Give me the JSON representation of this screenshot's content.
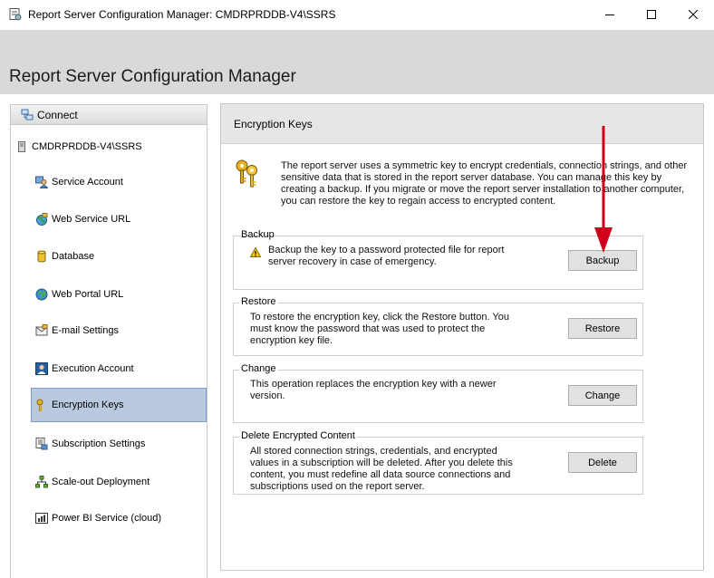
{
  "window": {
    "title": "Report Server Configuration Manager: CMDRPRDDB-V4\\SSRS",
    "controls": [
      "minimize-icon",
      "maximize-icon",
      "close-icon"
    ]
  },
  "header": {
    "app_title": "Report Server Configuration Manager"
  },
  "sidebar": {
    "connect_label": "Connect",
    "server_label": "CMDRPRDDB-V4\\SSRS",
    "items": [
      {
        "label": "Service Account",
        "icon": "service-account-icon"
      },
      {
        "label": "Web Service URL",
        "icon": "web-service-icon"
      },
      {
        "label": "Database",
        "icon": "database-icon"
      },
      {
        "label": "Web Portal URL",
        "icon": "globe-icon"
      },
      {
        "label": "E-mail Settings",
        "icon": "email-icon"
      },
      {
        "label": "Execution Account",
        "icon": "execution-account-icon"
      },
      {
        "label": "Encryption Keys",
        "icon": "key-icon",
        "selected": true
      },
      {
        "label": "Subscription Settings",
        "icon": "subscription-icon"
      },
      {
        "label": "Scale-out Deployment",
        "icon": "scaleout-icon"
      },
      {
        "label": "Power BI Service (cloud)",
        "icon": "power-bi-icon"
      }
    ]
  },
  "main": {
    "title": "Encryption Keys",
    "intro": "The report server uses a symmetric key to encrypt credentials, connection strings, and other sensitive data that is stored in the report server database.  You can manage this key by creating a backup.  If you migrate or move the report server installation to another computer, you can restore the key to regain access to encrypted content.",
    "groups": {
      "backup": {
        "title": "Backup",
        "text": "Backup the key to a password protected file for report server recovery in case of emergency.",
        "button": "Backup"
      },
      "restore": {
        "title": "Restore",
        "text": "To restore the encryption key, click the Restore button. You must know the password that was used to protect the encryption key file.",
        "button": "Restore"
      },
      "change": {
        "title": "Change",
        "text": "This operation replaces the encryption key with a newer version.",
        "button": "Change"
      },
      "delete": {
        "title": "Delete Encrypted Content",
        "text": "All stored connection strings, credentials, and encrypted values in a subscription will be deleted.  After you delete this content, you must redefine all data source connections and subscriptions used on the report server.",
        "button": "Delete"
      }
    }
  },
  "colors": {
    "highlight": "#fafaa0",
    "arrow": "#d0021b",
    "selected_nav": "#b9c9df"
  }
}
